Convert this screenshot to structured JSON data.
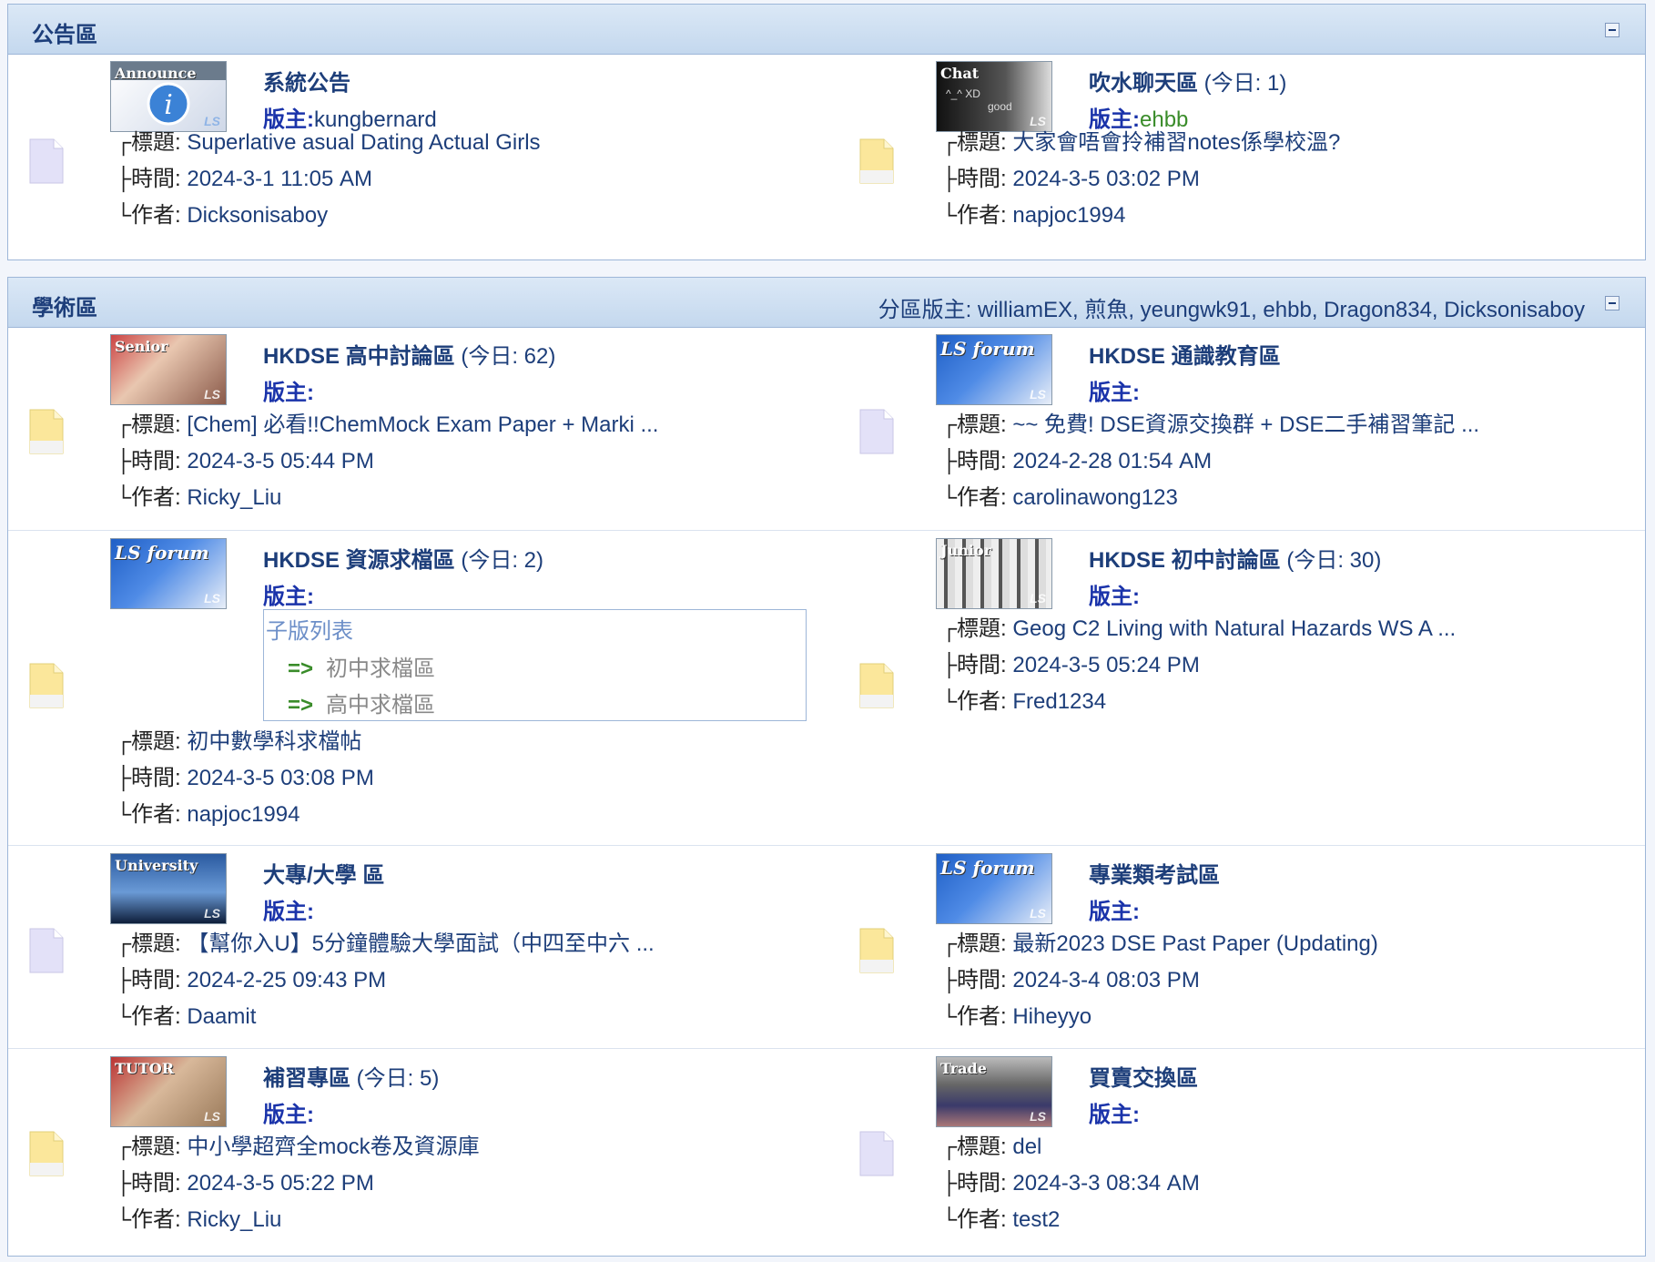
{
  "colors": {
    "link": "#1d3e7a",
    "moderator_label": "#1a33aa",
    "green_user": "#3a8c2a",
    "header_bg": "#c4d8ee"
  },
  "labels": {
    "subject": "┌標題: ",
    "time": "├時間: ",
    "author": "└作者: "
  },
  "announce": {
    "title": "公告區",
    "forums": [
      {
        "name": "系統公告",
        "today": "",
        "mod_label": "版主:",
        "mods": "kungbernard",
        "thumb": "Announce",
        "subject": "Superlative asual Dating Actual Girls",
        "time": "2024-3-1 11:05 AM",
        "author": "Dicksonisaboy"
      },
      {
        "name": "吹水聊天區",
        "today": " (今日: 1)",
        "mod_label": "版主:",
        "mods": "ehbb",
        "thumb": "Chat",
        "subject": "大家會唔會拎補習notes係學校溫?",
        "time": "2024-3-5 03:02 PM",
        "author": "napjoc1994"
      }
    ]
  },
  "academic": {
    "title": "學術區",
    "moderators": "分區版主: williamEX, 煎魚, yeungwk91, ehbb, Dragon834, Dicksonisaboy",
    "forums": [
      {
        "name": "HKDSE 高中討論區",
        "today": " (今日: 62)",
        "mod_label": "版主:",
        "thumb": "Senior",
        "subject": "[Chem] 必看!!ChemMock Exam Paper + Marki ...",
        "time": "2024-3-5 05:44 PM",
        "author": "Ricky_Liu"
      },
      {
        "name": "HKDSE 通識教育區",
        "today": "",
        "mod_label": "版主:",
        "thumb": "LS forum",
        "subject": "~~ 免費! DSE資源交換群 + DSE二手補習筆記 ...",
        "time": "2024-2-28 01:54 AM",
        "author": "carolinawong123"
      },
      {
        "name": "HKDSE 資源求檔區",
        "today": " (今日: 2)",
        "mod_label": "版主:",
        "thumb": "LS forum",
        "subforums_title": "子版列表",
        "subforums": [
          "初中求檔區",
          "高中求檔區"
        ],
        "subforum_arrow": "=>",
        "subject": "初中數學科求檔帖",
        "time": "2024-3-5 03:08 PM",
        "author": "napjoc1994"
      },
      {
        "name": "HKDSE 初中討論區",
        "today": " (今日: 30)",
        "mod_label": "版主:",
        "thumb": "Junior",
        "subject": "Geog C2 Living with Natural Hazards WS A ...",
        "time": "2024-3-5 05:24 PM",
        "author": "Fred1234"
      },
      {
        "name": "大專/大學 區",
        "today": "",
        "mod_label": "版主:",
        "thumb": "University",
        "subject": "【幫你入U】5分鐘體驗大學面試（中四至中六 ...",
        "time": "2024-2-25 09:43 PM",
        "author": "Daamit"
      },
      {
        "name": "專業類考試區",
        "today": "",
        "mod_label": "版主:",
        "thumb": "LS forum",
        "subject": "最新2023 DSE Past Paper (Updating)",
        "time": "2024-3-4 08:03 PM",
        "author": "Hiheyyo"
      },
      {
        "name": "補習專區",
        "today": " (今日: 5)",
        "mod_label": "版主:",
        "thumb": "TUTOR",
        "subject": "中小學超齊全mock卷及資源庫",
        "time": "2024-3-5 05:22 PM",
        "author": "Ricky_Liu"
      },
      {
        "name": "買賣交換區",
        "today": "",
        "mod_label": "版主:",
        "thumb": "Trade",
        "subject": "del",
        "time": "2024-3-3 08:34 AM",
        "author": "test2"
      }
    ]
  }
}
